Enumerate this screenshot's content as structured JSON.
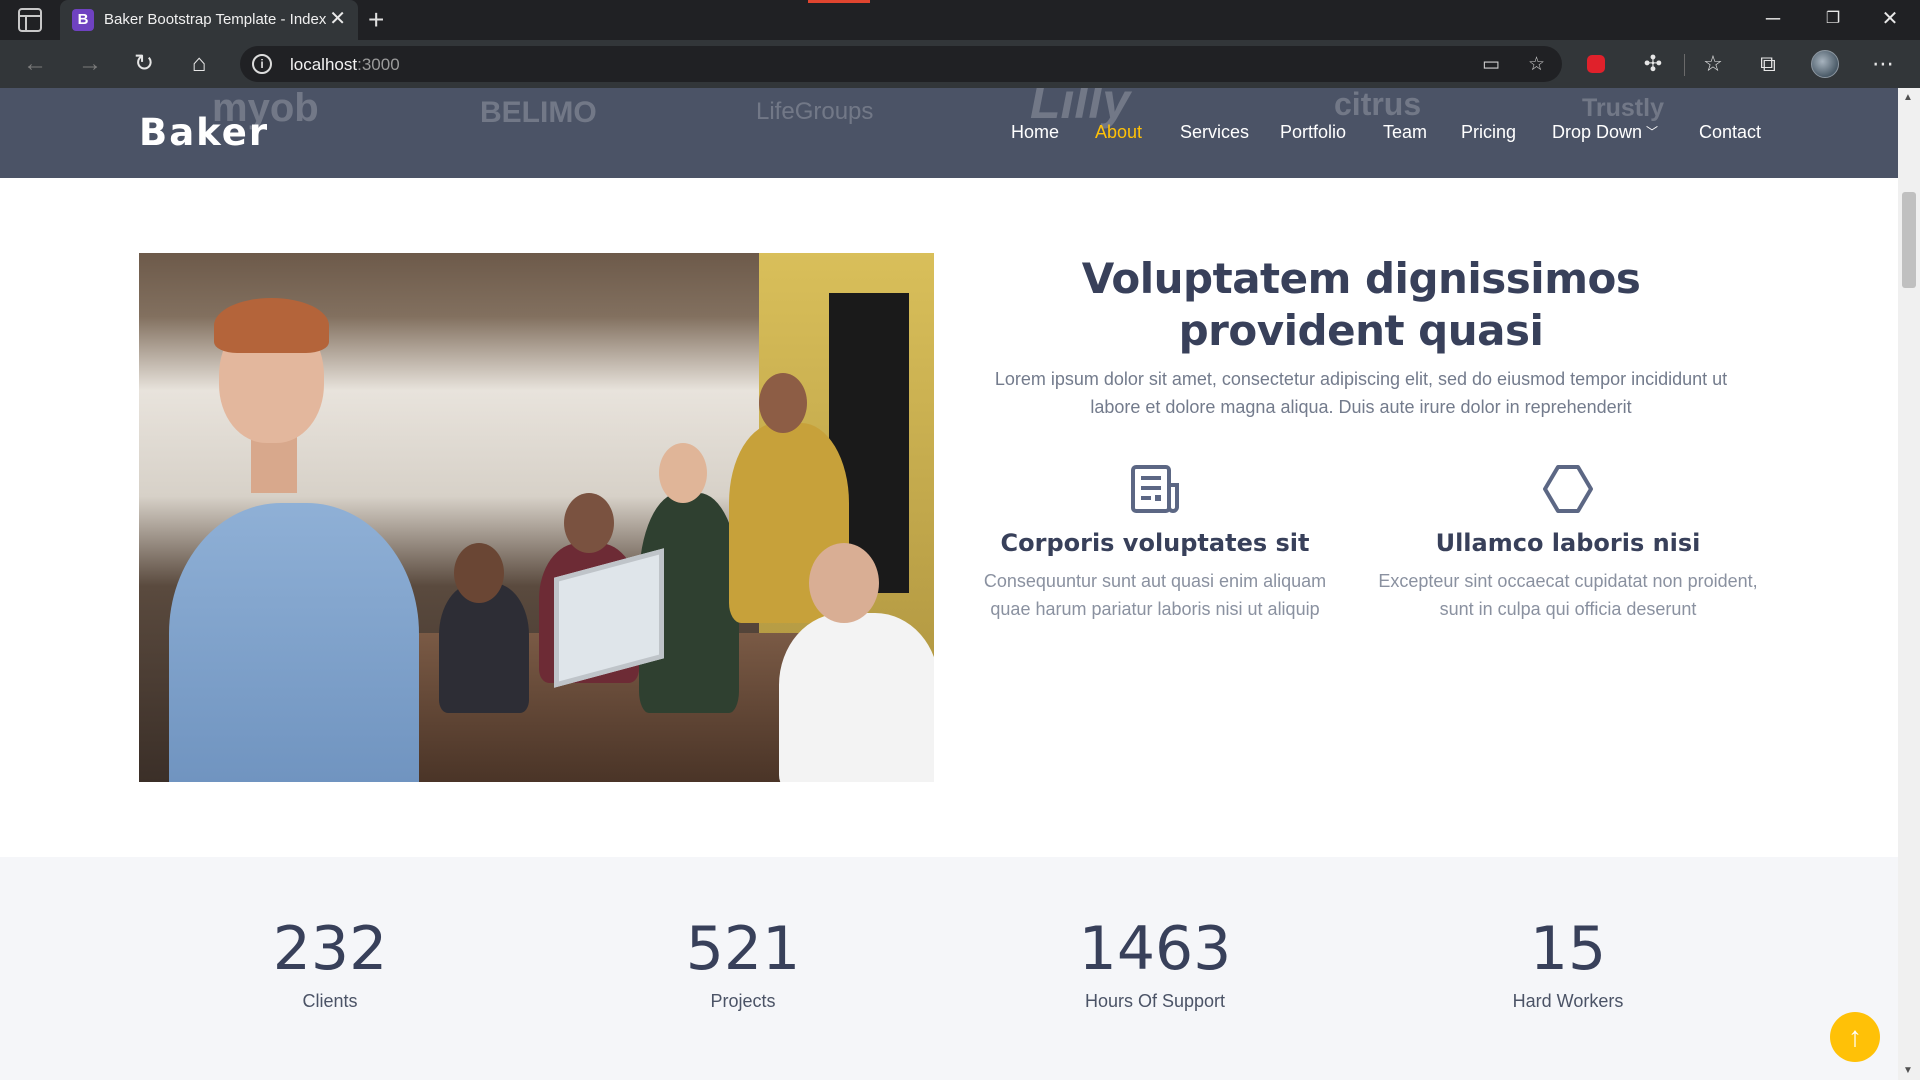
{
  "browser": {
    "tab_title": "Baker Bootstrap Template - Index",
    "tab_favicon_letter": "B",
    "url_host": "localhost",
    "url_port": ":3000",
    "icons": [
      "sidebar-tabs-icon",
      "close-icon",
      "plus-icon",
      "minimize-icon",
      "restore-icon",
      "close-window-icon",
      "back-icon",
      "forward-icon",
      "refresh-icon",
      "home-icon",
      "info-icon",
      "reader-mode-icon",
      "favorite-add-icon",
      "extension-lock-icon",
      "puzzle-icon",
      "favorites-icon",
      "collections-icon",
      "profile-avatar",
      "more-icon"
    ]
  },
  "header": {
    "brand": "Baker",
    "nav": [
      {
        "label": "Home",
        "active": false
      },
      {
        "label": "About",
        "active": true
      },
      {
        "label": "Services",
        "active": false
      },
      {
        "label": "Portfolio",
        "active": false
      },
      {
        "label": "Team",
        "active": false
      },
      {
        "label": "Pricing",
        "active": false
      },
      {
        "label": "Drop Down",
        "active": false,
        "dropdown": true
      },
      {
        "label": "Contact",
        "active": false
      }
    ],
    "client_logos": [
      "myob",
      "BELIMO",
      "LifeGroups",
      "Lilly",
      "citrus",
      "Trustly"
    ],
    "accent_color": "#ffc107",
    "header_color": "#4b5366"
  },
  "about": {
    "title": "Voluptatem dignissimos provident quasi",
    "lead": "Lorem ipsum dolor sit amet, consectetur adipiscing elit, sed do eiusmod tempor incididunt ut labore et dolore magna aliqua. Duis aute irure dolor in reprehenderit",
    "features": [
      {
        "icon": "newspaper-icon",
        "title": "Corporis voluptates sit",
        "text": "Consequuntur sunt aut quasi enim aliquam quae harum pariatur laboris nisi ut aliquip"
      },
      {
        "icon": "hexagon-icon",
        "title": "Ullamco laboris nisi",
        "text": "Excepteur sint occaecat cupidatat non proident, sunt in culpa qui officia deserunt"
      }
    ]
  },
  "counts": [
    {
      "number": "232",
      "label": "Clients"
    },
    {
      "number": "521",
      "label": "Projects"
    },
    {
      "number": "1463",
      "label": "Hours Of Support"
    },
    {
      "number": "15",
      "label": "Hard Workers"
    }
  ],
  "back_to_top_icon": "arrow-up-icon"
}
